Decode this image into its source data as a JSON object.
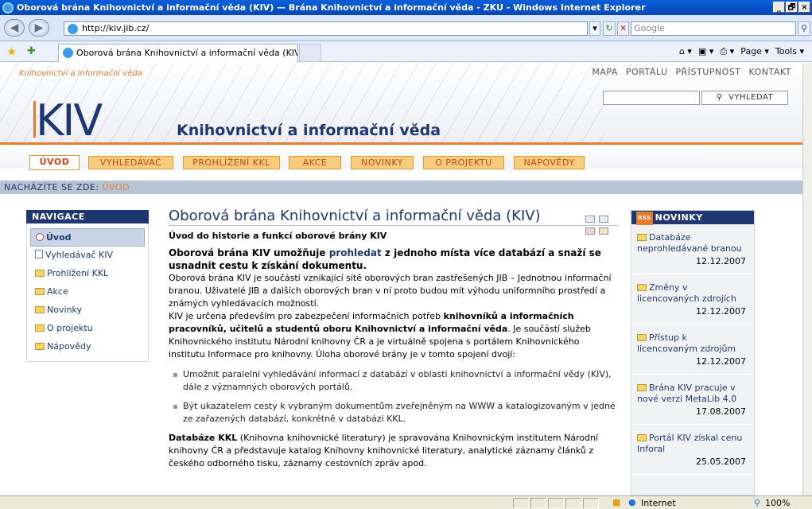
{
  "window": {
    "title": "Oborová brána Knihovnictví a informační věda (KIV) — Brána Knihovnictví a informační věda - ZKU - Windows Internet Explorer",
    "minimize": "_",
    "maximize": "🗗",
    "close": "×"
  },
  "browser": {
    "url": "http://kiv.jib.cz/",
    "search_placeholder": "Google",
    "tab_title": "Oborová brána Knihovnictví a informační věda (KIV) ...",
    "cmd_page": "Page ▾",
    "cmd_tools": "Tools ▾",
    "status_zone": "Internet",
    "zoom": "100%"
  },
  "site": {
    "logo": "KIV",
    "logo_arc": "Knihovnictví a informační věda",
    "subtitle": "Knihovnictví a informační věda",
    "top_links": [
      "MAPA PORTÁLU",
      "PŘÍSTUPNOST",
      "KONTAKT"
    ],
    "search_button": "VYHLEDAT",
    "menu": [
      "ÚVOD",
      "VYHLEDÁVAČ",
      "PROHLÍŽENÍ KKL",
      "AKCE",
      "NOVINKY",
      "O PROJEKTU",
      "NÁPOVĚDY"
    ],
    "breadcrumb_label": "NACHÁZÍTE SE ZDE:",
    "breadcrumb_link": "ÚVOD"
  },
  "navigation": {
    "heading": "NAVIGACE",
    "items": [
      "Úvod",
      "Vyhledávač KIV",
      "Prohlížení KKL",
      "Akce",
      "Novinky",
      "O projektu",
      "Nápovědy"
    ]
  },
  "article": {
    "title": "Oborová brána Knihovnictví a informační věda (KIV)",
    "subheading": "Úvod do historie a funkcí oborové brány KIV",
    "intro_a": "Oborová brána KIV umožňuje ",
    "intro_link": "prohledat",
    "intro_b": " z jednoho místa více databází a snaží se usnadnit cestu k získání dokumentu.",
    "p1": "Oborová brána KIV je součástí vznikající sítě oborových bran zastřešených JIB – Jednotnou informační branou. Uživatelé JIB a dalších oborových bran v ní proto budou mít výhodu uniformního prostředí a známých vyhledávacích možností.",
    "p2a": "KIV je určena především pro zabezpečení informačních potřeb ",
    "p2b": "knihovníků a informačních pracovníků, učitelů a studentů oboru Knihovnictví a informační věda",
    "p2c": ". Je součástí služeb Knihovnického institutu Národní knihovny ČR a je virtuálně spojena s portálem Knihovnického institutu Informace pro knihovny. Úloha oborové brány je v tomto spojení dvojí:",
    "bullets": [
      "Umožnit paralelní vyhledávání informací z databází v oblasti knihovnictví a informační vědy (KIV), dále z významných oborových portálů.",
      "Být ukazatelem cesty k vybraným dokumentům zveřejněným na WWW a katalogizovaným v jedné ze zařazených databází, konkrétně v databázi KKL."
    ],
    "p3a": "Databáze KKL",
    "p3b": " (Knihovna knihovnické literatury) je spravována Knihovnickým institutem Národní knihovny ČR a představuje katalog Knihovny knihovnické literatury, analytické záznamy článků z českého odborného tisku, záznamy cestovních zpráv apod."
  },
  "news": {
    "heading": "NOVINKY",
    "rss": "RSS",
    "items": [
      {
        "title": "Databáze neprohledávané branou",
        "date": "12.12.2007"
      },
      {
        "title": "Změny v licencovaných zdrojích",
        "date": "12.12.2007"
      },
      {
        "title": "Přístup k licencovaným zdrojům",
        "date": "12.12.2007"
      },
      {
        "title": "Brána KIV pracuje v nové verzi MetaLib 4.0",
        "date": "17.08.2007"
      },
      {
        "title": "Portál KIV získal cenu Inforal",
        "date": "25.05.2007"
      }
    ]
  }
}
